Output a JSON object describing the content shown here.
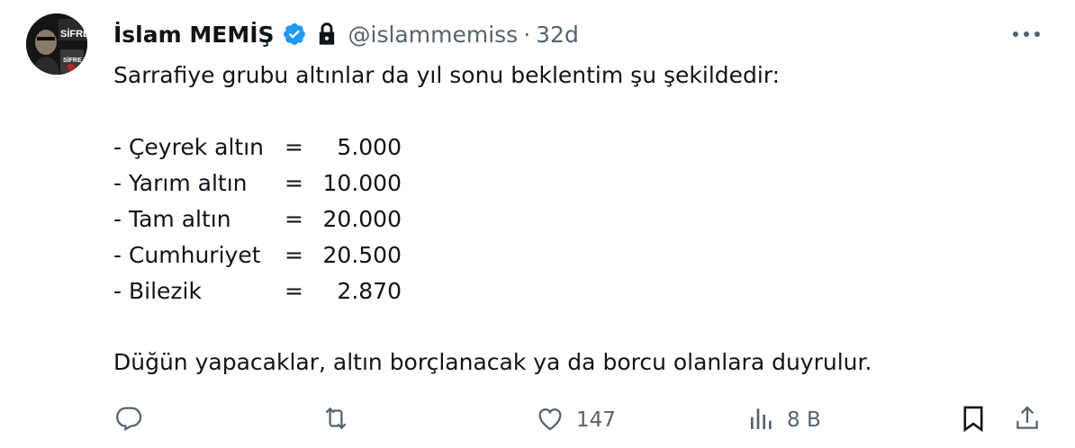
{
  "tweet": {
    "author_name": "İslam MEMİŞ",
    "handle": "@islammemiss",
    "separator": "·",
    "time": "32d",
    "intro": "Sarrafiye grubu altınlar da yıl sonu beklentim şu şekildedir:",
    "items": [
      {
        "label": "- Çeyrek altın",
        "eq": "=",
        "value": "5.000"
      },
      {
        "label": "- Yarım altın",
        "eq": "=",
        "value": "10.000"
      },
      {
        "label": "- Tam altın",
        "eq": "=",
        "value": "20.000"
      },
      {
        "label": "- Cumhuriyet",
        "eq": "=",
        "value": "20.500"
      },
      {
        "label": "- Bilezik",
        "eq": "=",
        "value": "2.870"
      }
    ],
    "closing": "Düğün yapacaklar, altın borçlanacak ya da borcu olanlara duyrulur.",
    "avatar_text": [
      "SİFRE",
      "SİFRE"
    ]
  },
  "actions": {
    "likes": "147",
    "views": "8 B"
  },
  "colors": {
    "verified": "#1d9bf0",
    "muted": "#536471",
    "text": "#0f1419"
  },
  "icons": [
    "reply-icon",
    "retweet-icon",
    "like-icon",
    "views-icon",
    "bookmark-icon",
    "share-icon",
    "more-icon",
    "verified-icon",
    "lock-icon"
  ]
}
